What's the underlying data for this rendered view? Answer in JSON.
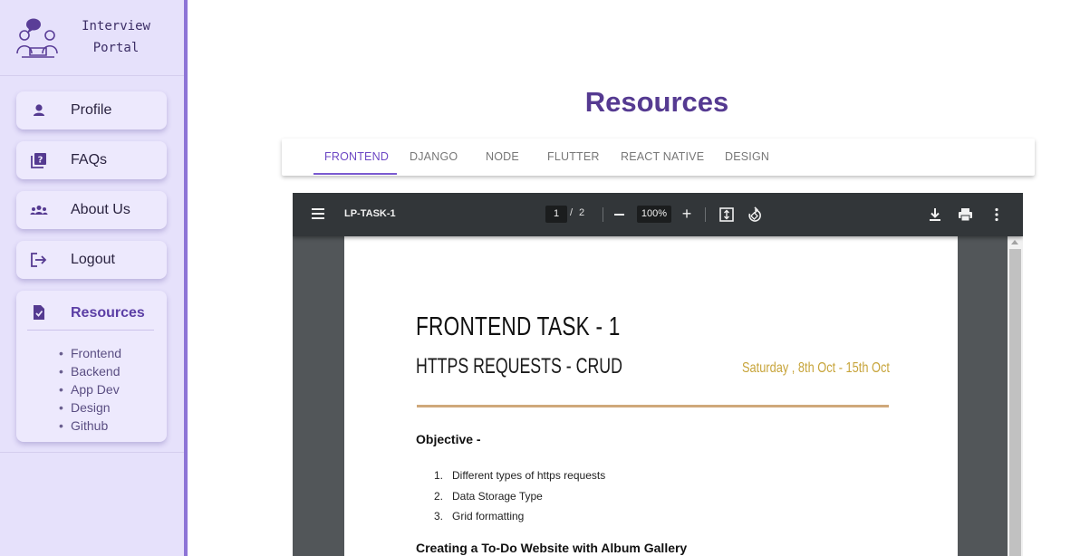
{
  "brand": {
    "line1": "Interview",
    "line2": "Portal"
  },
  "sidebar": {
    "items": [
      {
        "label": "Profile",
        "icon": "person-icon"
      },
      {
        "label": "FAQs",
        "icon": "faq-icon"
      },
      {
        "label": "About Us",
        "icon": "group-icon"
      },
      {
        "label": "Logout",
        "icon": "logout-icon"
      }
    ],
    "resources": {
      "label": "Resources",
      "icon": "assignment-icon",
      "links": [
        "Frontend",
        "Backend",
        "App Dev",
        "Design",
        "Github"
      ]
    }
  },
  "page": {
    "title": "Resources"
  },
  "tabs": {
    "active_index": 0,
    "items": [
      "FRONTEND",
      "DJANGO",
      "NODE",
      "FLUTTER",
      "REACT NATIVE",
      "DESIGN"
    ]
  },
  "viewer": {
    "file_name": "LP-TASK-1",
    "page": "1",
    "separator": "/",
    "total_pages": "2",
    "zoom": "100%"
  },
  "document": {
    "title": "FRONTEND TASK - 1",
    "subtitle": "HTTPS REQUESTS - CRUD",
    "date": "Saturday , 8th Oct - 15th Oct",
    "objective_heading": "Objective -",
    "objectives": [
      {
        "num": "1.",
        "text": "Different types of https requests"
      },
      {
        "num": "2.",
        "text": "Data Storage Type"
      },
      {
        "num": "3.",
        "text": "Grid formatting"
      }
    ],
    "section_heading": "Creating a To-Do Website with Album Gallery"
  },
  "colors": {
    "sidebar_bg": "#e6e1fb",
    "accent": "#553a91",
    "tab_active": "#6d48c4",
    "viewer_toolbar": "#323639",
    "viewer_bg": "#525659",
    "date_gold": "#c7a43a",
    "rule_tan": "#cfa87a"
  }
}
